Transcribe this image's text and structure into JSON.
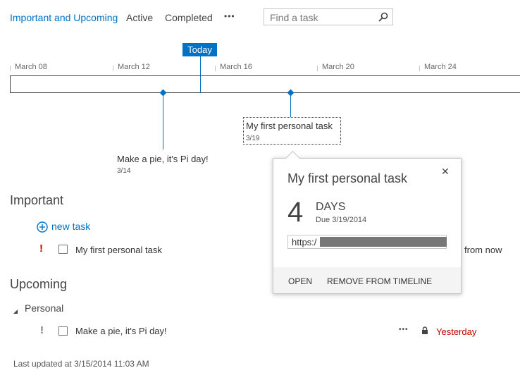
{
  "nav": {
    "tabs": [
      "Important and Upcoming",
      "Active",
      "Completed"
    ],
    "more_label": "•••",
    "search_placeholder": "Find a task"
  },
  "timeline": {
    "today_label": "Today",
    "dates": [
      "March 08",
      "March 12",
      "March 16",
      "March 20",
      "March 24"
    ],
    "items": [
      {
        "title": "Make a pie, it's Pi day!",
        "date": "3/14"
      },
      {
        "title": "My first personal task",
        "date": "3/19"
      }
    ]
  },
  "important": {
    "title": "Important",
    "new_task_label": "new task",
    "tasks": [
      {
        "priority": "!",
        "title": "My first personal task",
        "due": "from now"
      }
    ]
  },
  "upcoming": {
    "title": "Upcoming",
    "group_label": "Personal",
    "tasks": [
      {
        "priority": "!",
        "title": "Make a pie, it's Pi day!",
        "more": "•••",
        "due": "Yesterday"
      }
    ]
  },
  "callout": {
    "title": "My first personal task",
    "days_number": "4",
    "days_label": "DAYS",
    "due_text": "Due 3/19/2014",
    "url_prefix": "https:/",
    "open_label": "OPEN",
    "remove_label": "REMOVE FROM TIMELINE",
    "close_glyph": "✕"
  },
  "footer": {
    "last_updated": "Last updated at 3/15/2014 11:03 AM"
  },
  "colors": {
    "accent": "#0072c6",
    "priority_red": "#c00000",
    "overdue_red": "#c00000"
  }
}
